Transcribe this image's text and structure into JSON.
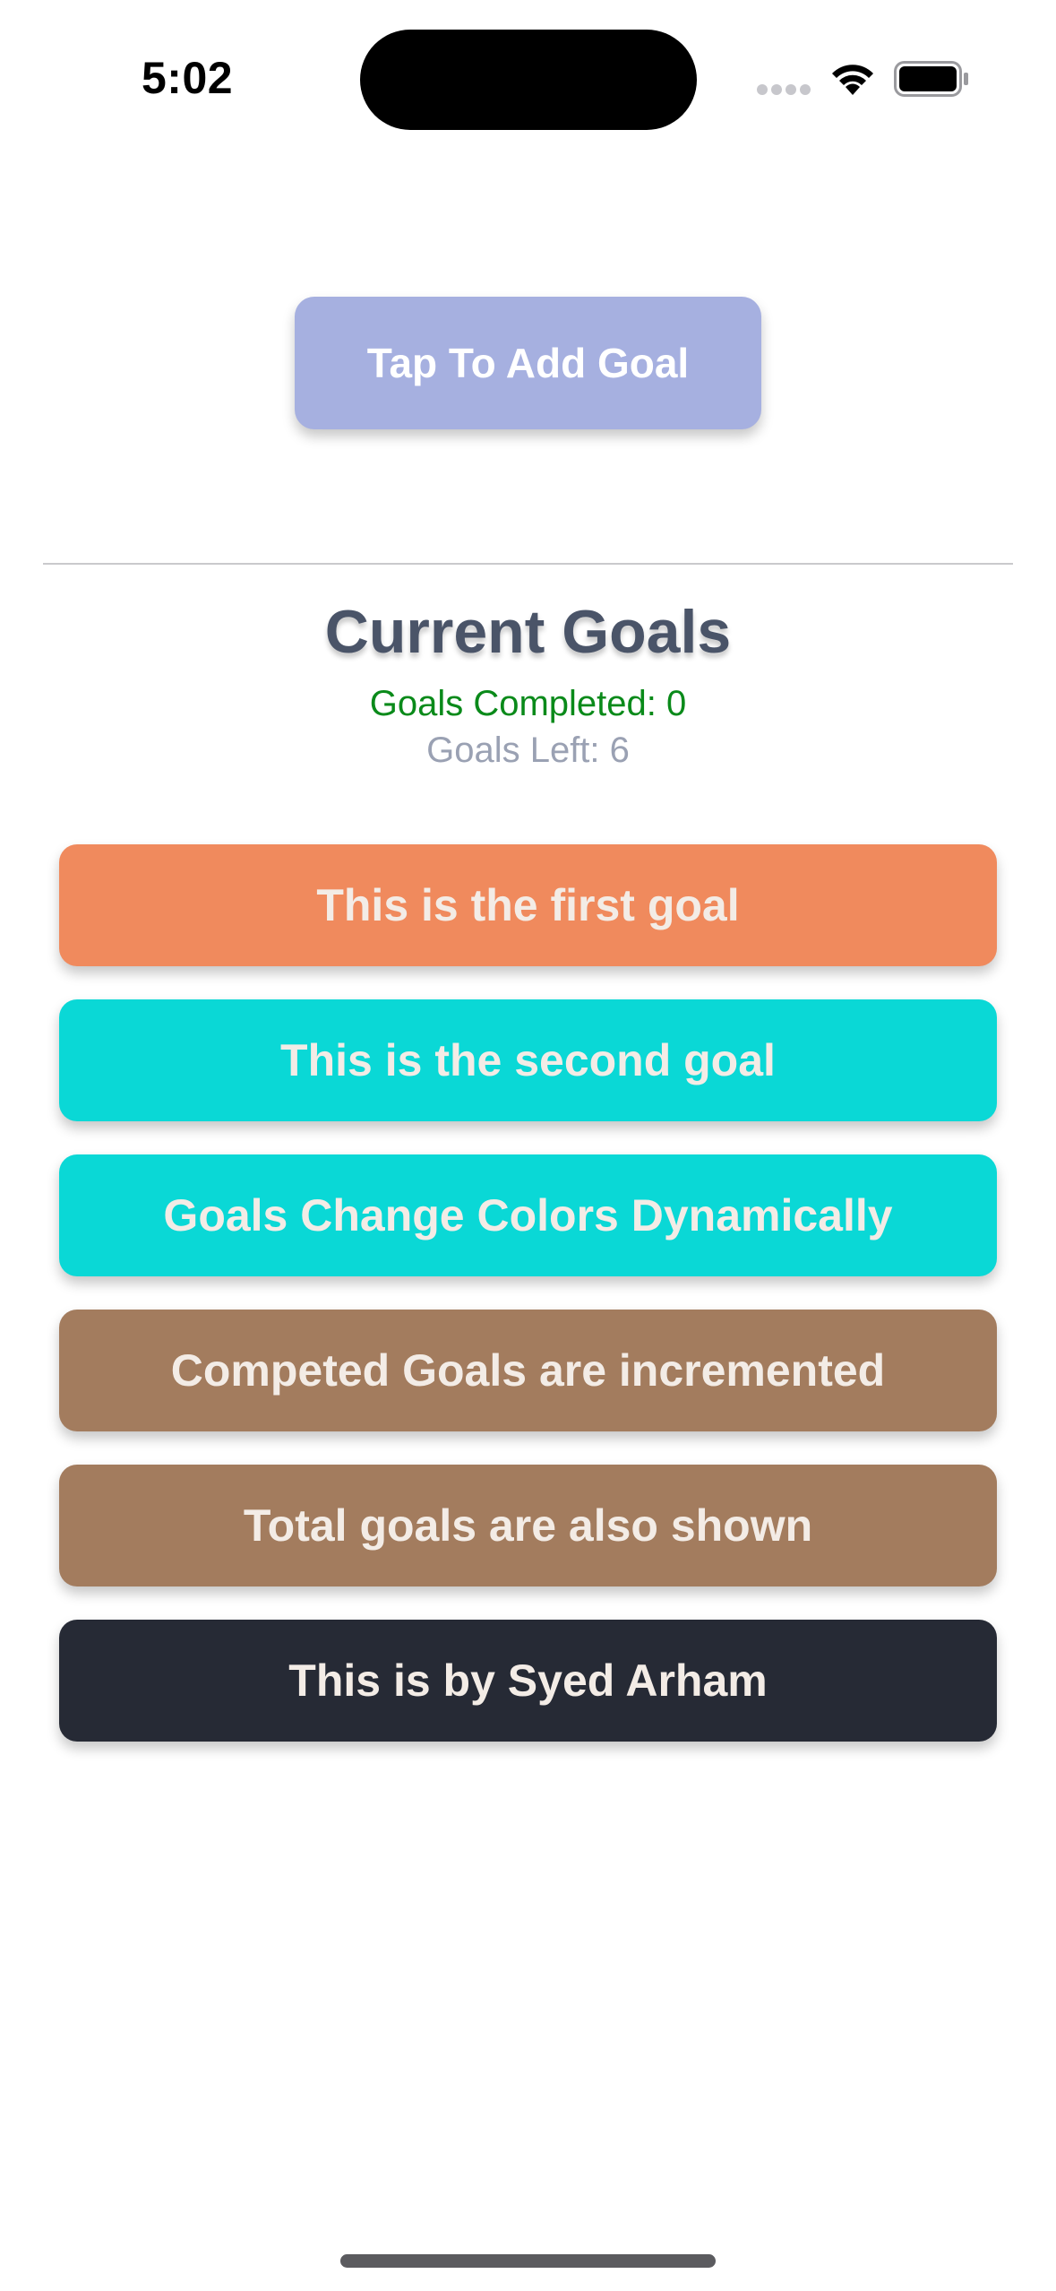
{
  "status_bar": {
    "time": "5:02"
  },
  "add_goal_button": {
    "label": "Tap To Add Goal",
    "color": "#a6b0e0"
  },
  "goals_section": {
    "title": "Current Goals",
    "completed_text": "Goals Completed: 0",
    "left_text": "Goals Left: 6"
  },
  "goals": [
    {
      "label": "This is the first goal",
      "color": "#f08a5d"
    },
    {
      "label": "This is the second goal",
      "color": "#0ad8d6"
    },
    {
      "label": "Goals Change Colors Dynamically",
      "color": "#0ad8d6"
    },
    {
      "label": "Competed Goals are incremented",
      "color": "#a37c5e"
    },
    {
      "label": "Total goals are also shown",
      "color": "#a37c5e"
    },
    {
      "label": "This is by Syed Arham",
      "color": "#262a35"
    }
  ]
}
